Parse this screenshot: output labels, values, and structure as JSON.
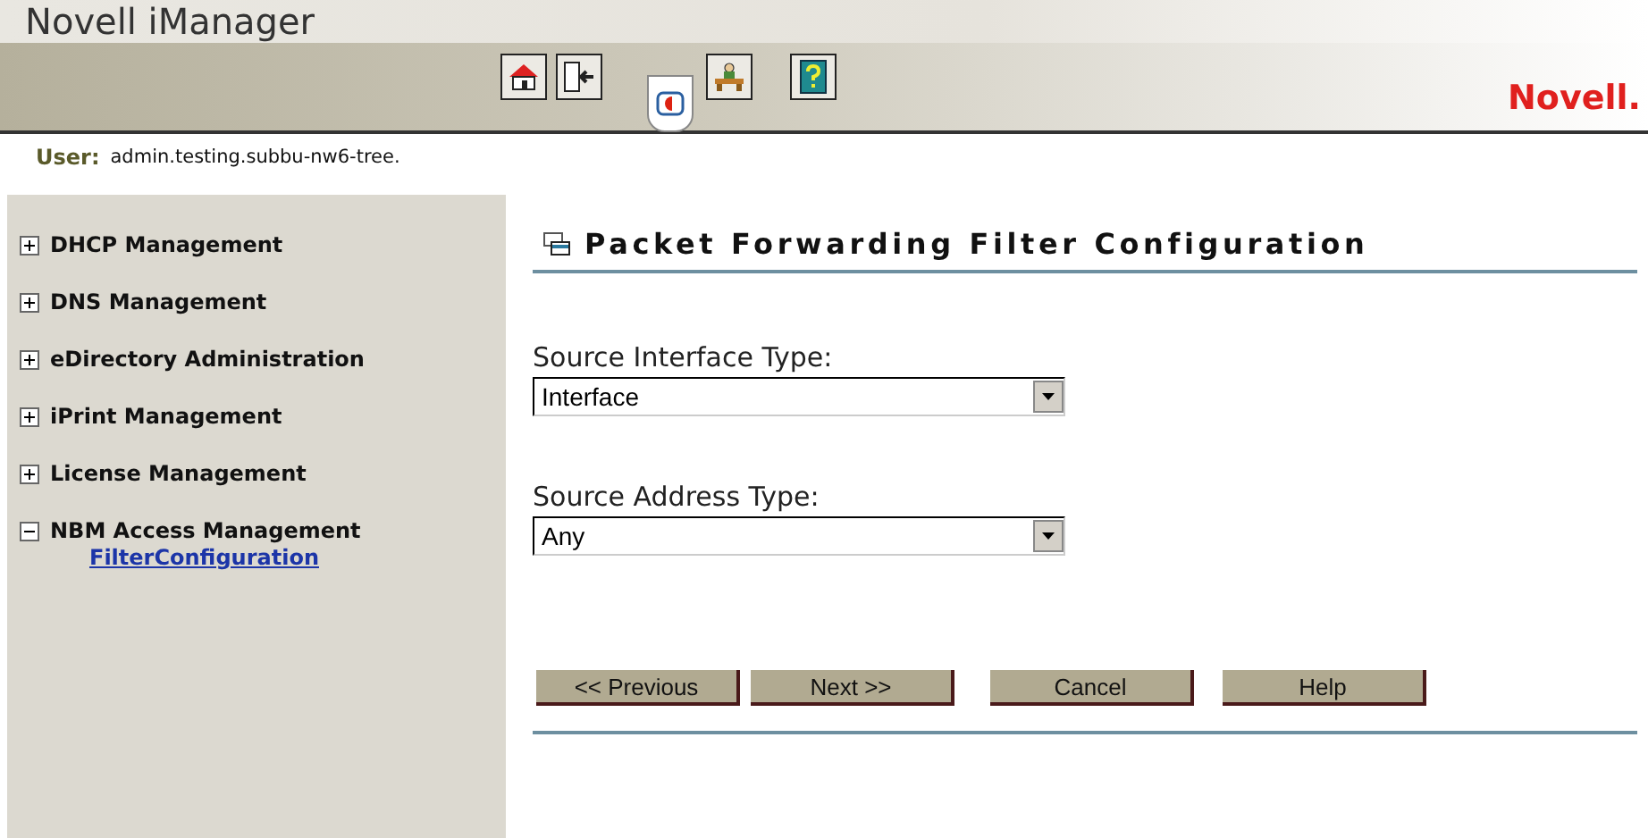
{
  "header": {
    "title": "Novell iManager",
    "brand": "Novell.",
    "toolbar": [
      {
        "kind": "home",
        "selected": false
      },
      {
        "kind": "exit",
        "selected": false
      },
      {
        "kind": "roles",
        "selected": true
      },
      {
        "kind": "desk",
        "selected": false
      },
      {
        "kind": "help",
        "selected": false
      }
    ]
  },
  "user": {
    "label": "User:",
    "value": "admin.testing.subbu-nw6-tree."
  },
  "sidebar": {
    "items": [
      {
        "label": "DHCP Management",
        "expanded": false
      },
      {
        "label": "DNS Management",
        "expanded": false
      },
      {
        "label": "eDirectory Administration",
        "expanded": false
      },
      {
        "label": "iPrint Management",
        "expanded": false
      },
      {
        "label": "License Management",
        "expanded": false
      },
      {
        "label": "NBM Access Management",
        "expanded": true,
        "children": [
          {
            "label": "FilterConfiguration"
          }
        ]
      }
    ]
  },
  "page": {
    "title": "Packet Forwarding Filter Configuration",
    "fields": [
      {
        "label": "Source Interface Type:",
        "value": "Interface"
      },
      {
        "label": "Source Address Type:",
        "value": "Any"
      }
    ],
    "buttons": [
      "<< Previous",
      "Next >>",
      "Cancel",
      "Help"
    ]
  }
}
